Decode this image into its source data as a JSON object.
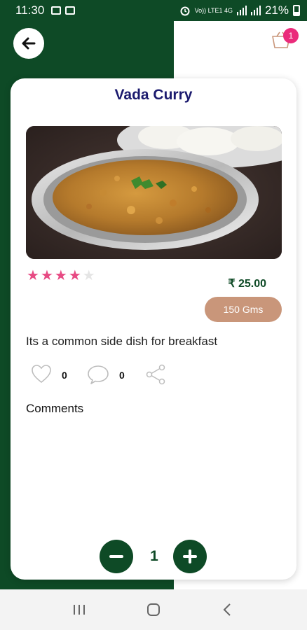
{
  "status_bar": {
    "time": "11:30",
    "network_label": "Vo)) LTE1 4G",
    "battery_percent": "21%"
  },
  "header": {
    "back_icon": "arrow-left-icon",
    "cart_icon": "cart-icon",
    "cart_count": "1"
  },
  "product": {
    "title": "Vada Curry",
    "image_description": "bowl-of-vada-curry-photo",
    "rating": 4,
    "rating_max": 5,
    "price": "₹ 25.00",
    "weight": "150 Gms",
    "description": "Its a common side dish for breakfast"
  },
  "social": {
    "likes": "0",
    "comments": "0"
  },
  "comments_heading": "Comments",
  "quantity": {
    "value": "1"
  },
  "colors": {
    "primary_green": "#0e4a26",
    "title_navy": "#1b1a6e",
    "star_pink": "#e74a83",
    "badge_pink": "#ea2b7b",
    "weight_tan": "#c9967a"
  }
}
